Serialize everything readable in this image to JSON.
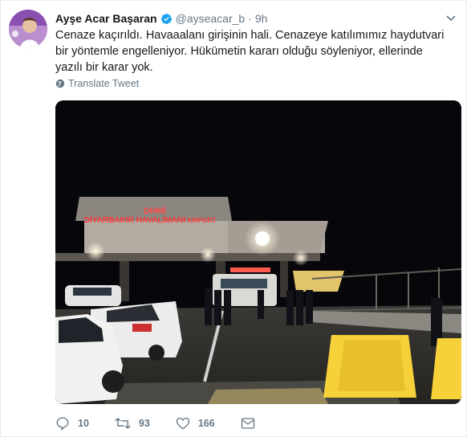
{
  "user": {
    "name": "Ayşe Acar Başaran",
    "handle": "@ayseacar_b",
    "separator": "·",
    "time": "9h"
  },
  "tweet": {
    "text": "Cenaze kaçırıldı. Havaaalanı girişinin hali. Cenazeye katılımımız haydutvari bir yöntemle engelleniyor. Hükümetin kararı olduğu söyleniyor, ellerinde yazılı bir karar yok.",
    "translate_label": "Translate Tweet"
  },
  "media": {
    "sign_line1": "DHMİ",
    "sign_line2": "DİYARBAKIR HAVALİMANI",
    "sign_line3": "/ AIRPORT"
  },
  "actions": {
    "replies": "10",
    "retweets": "93",
    "likes": "166"
  },
  "colors": {
    "accent": "#1da1f2",
    "muted": "#657786",
    "text": "#14171a"
  }
}
